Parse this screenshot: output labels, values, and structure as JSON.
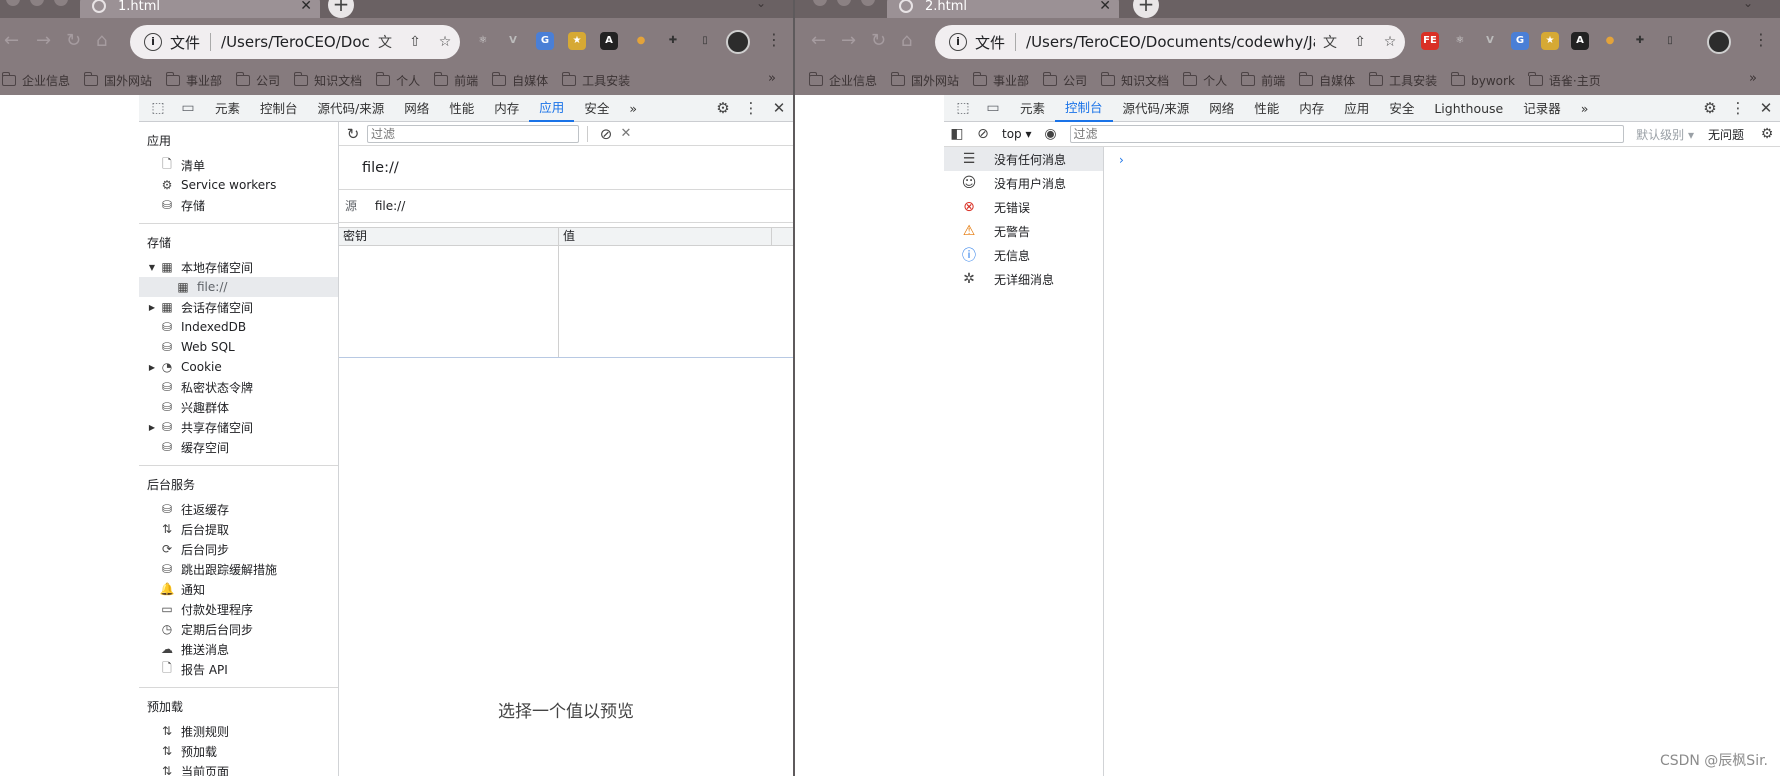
{
  "left": {
    "tab_title": "1.html",
    "omnibox": {
      "scheme_label": "文件",
      "url": "/Users/TeroCEO/Doc..."
    },
    "bookmarks": [
      "企业信息",
      "国外网站",
      "事业部",
      "公司",
      "知识文档",
      "个人",
      "前端",
      "自媒体",
      "工具安装"
    ],
    "devtools_tabs": [
      "元素",
      "控制台",
      "源代码/来源",
      "网络",
      "性能",
      "内存",
      "应用",
      "安全"
    ],
    "active_tab": "应用",
    "sidebar": {
      "app_heading": "应用",
      "app_items": [
        {
          "label": "清单",
          "icon": "file-icon"
        },
        {
          "label": "Service workers",
          "icon": "gears-icon"
        },
        {
          "label": "存储",
          "icon": "database-icon"
        }
      ],
      "storage_heading": "存储",
      "storage_items": [
        {
          "label": "本地存储空间",
          "icon": "table-icon",
          "expanded": true
        },
        {
          "label": "file://",
          "icon": "table-icon",
          "selected": true
        },
        {
          "label": "会话存储空间",
          "icon": "table-icon"
        },
        {
          "label": "IndexedDB",
          "icon": "database-icon"
        },
        {
          "label": "Web SQL",
          "icon": "database-icon"
        },
        {
          "label": "Cookie",
          "icon": "cookie-icon"
        },
        {
          "label": "私密状态令牌",
          "icon": "database-icon"
        },
        {
          "label": "兴趣群体",
          "icon": "database-icon"
        },
        {
          "label": "共享存储空间",
          "icon": "database-icon"
        },
        {
          "label": "缓存空间",
          "icon": "database-icon"
        }
      ],
      "bg_heading": "后台服务",
      "bg_items": [
        {
          "label": "往返缓存",
          "icon": "database-icon"
        },
        {
          "label": "后台提取",
          "icon": "arrows-icon"
        },
        {
          "label": "后台同步",
          "icon": "sync-icon"
        },
        {
          "label": "跳出跟踪缓解措施",
          "icon": "database-icon"
        },
        {
          "label": "通知",
          "icon": "bell-icon"
        },
        {
          "label": "付款处理程序",
          "icon": "card-icon"
        },
        {
          "label": "定期后台同步",
          "icon": "clock-icon"
        },
        {
          "label": "推送消息",
          "icon": "cloud-icon"
        },
        {
          "label": "报告 API",
          "icon": "file-icon"
        }
      ],
      "preload_heading": "预加载",
      "preload_items": [
        {
          "label": "推测规则",
          "icon": "arrows-icon"
        },
        {
          "label": "预加载",
          "icon": "arrows-icon"
        },
        {
          "label": "当前页面",
          "icon": "arrows-icon"
        }
      ]
    },
    "filter_placeholder": "过滤",
    "origin_title": "file://",
    "source_label": "源",
    "source_value": "file://",
    "grid_headers": [
      "密钥",
      "值"
    ],
    "preview_text": "选择一个值以预览"
  },
  "right": {
    "tab_title": "2.html",
    "omnibox": {
      "scheme_label": "文件",
      "url": "/Users/TeroCEO/Documents/codewhy/Java..."
    },
    "bookmarks": [
      "企业信息",
      "国外网站",
      "事业部",
      "公司",
      "知识文档",
      "个人",
      "前端",
      "自媒体",
      "工具安装",
      "bywork",
      "语雀·主页"
    ],
    "devtools_tabs": [
      "元素",
      "控制台",
      "源代码/来源",
      "网络",
      "性能",
      "内存",
      "应用",
      "安全",
      "Lighthouse",
      "记录器"
    ],
    "active_tab": "控制台",
    "context": "top",
    "filter_placeholder": "过滤",
    "levels": "默认级别",
    "issues": "无问题",
    "messages": [
      {
        "label": "没有任何消息",
        "icon": "list-icon",
        "color": "#444444"
      },
      {
        "label": "没有用户消息",
        "icon": "user-icon",
        "color": "#444444"
      },
      {
        "label": "无错误",
        "icon": "error-icon",
        "color": "#d93025"
      },
      {
        "label": "无警告",
        "icon": "warning-icon",
        "color": "#e37400"
      },
      {
        "label": "无信息",
        "icon": "info-icon",
        "color": "#1a73e8"
      },
      {
        "label": "无详细消息",
        "icon": "bug-icon",
        "color": "#444444"
      }
    ],
    "prompt": "›"
  },
  "watermark": "CSDN @辰枫Sir."
}
